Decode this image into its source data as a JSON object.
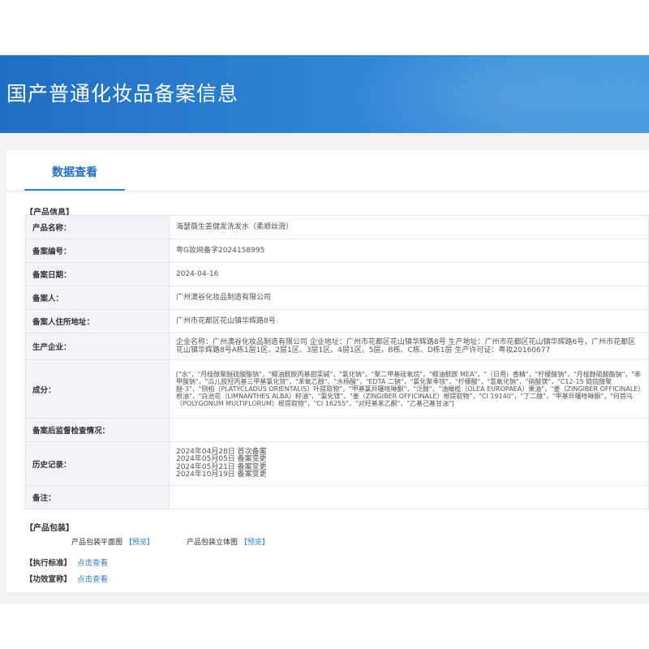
{
  "banner": {
    "title": "国产普通化妆品备案信息"
  },
  "tabs": [
    {
      "label": "数据查看"
    }
  ],
  "sections": {
    "product_info": "【产品信息】",
    "package": "【产品包装】",
    "standard": "【执行标准】",
    "claims": "【功效宣称】"
  },
  "rows": {
    "name": {
      "label": "产品名称：",
      "value": "海瑟薇生姜健发洗发水（柔顺丝滑）"
    },
    "record_no": {
      "label": "备案编号：",
      "value": "粤G妆网备字2024158995"
    },
    "record_date": {
      "label": "备案日期：",
      "value": "2024-04-16"
    },
    "registrant": {
      "label": "备案人：",
      "value": "广州澳谷化妆品制造有限公司"
    },
    "address": {
      "label": "备案人住所地址：",
      "value": "广州市花都区花山镇华辉路8号"
    },
    "manufacturer": {
      "label": "生产企业：",
      "value": "企业名称：广州澳谷化妆品制造有限公司 企业地址：广州市花都区花山镇华辉路8号 生产地址：广州市花都区花山镇华辉路6号，广州市花都区花山镇华辉路8号A栋1层1区、2层1区、3层1区、4层1区、5层，B栋、C栋、D栋1层 生产许可证：粤妆20160677"
    },
    "ingredients": {
      "label": "成分：",
      "value": "[\"水\"，\"月桂醇聚醚硫酸酯钠\"，\"椰油酰胺丙基甜菜碱\"，\"氯化钠\"，\"聚二甲基硅氧烷\"，\"椰油酰胺 MEA\"，\"（日用）香精\"，\"柠檬酸钠\"，\"月桂醇硫酸酯钠\"，\"苯甲酸钠\"，\"瓜儿胶羟丙基三甲基氯化铵\"，\"苯氧乙醇\"，\"水杨酸\"，\"EDTA 二钠\"，\"氯化聚季铵\"，\"柠檬酸\"，\"氢氧化钠\"，\"硝酸镁\"，\"C12-15 链烷醇聚醚-3\"，\"侧柏（PLATYCLADUS ORIENTALIS）叶提取物\"，\"甲基氯异噻唑啉酮\"，\"泛醇\"，\"油橄榄（OLEA EUROPAEA）果油\"，\"姜（ZINGIBER OFFICINALE）根油\"，\"白池花（LIMNANTHES ALBA）籽油\"，\"氯化镁\"，\"姜（ZINGIBER OFFICINALE）根提取物\"，\"CI 19140\"，\"丁二醇\"，\"甲基异噻唑啉酮\"，\"何首乌（POLYGONUM MULTIFLORUM）根提取物\"，\"CI 16255\"，\"对羟基苯乙酮\"，\"乙基己基甘油\"]"
    },
    "inspection": {
      "label": "备案后监督检查情况：",
      "value": ""
    },
    "history": {
      "label": "历史记录：",
      "values": [
        "2024年04月28日 首次备案",
        "2024年05月05日 备案变更",
        "2024年05月21日 备案变更",
        "2024年10月19日 备案变更"
      ]
    },
    "notes": {
      "label": "备注：",
      "value": ""
    }
  },
  "package": {
    "flat_label": "产品包装平面图",
    "flat_link": "【预览】",
    "solid_label": "产品包装立体图",
    "solid_link": "【预览】"
  },
  "standard_link": "点击查看",
  "claims_link": "点击查看",
  "colors": {
    "banner": "#2f86d6",
    "link": "#2f7fd0",
    "label_bg": "#f2f4f7",
    "border": "#e4e6ea"
  }
}
